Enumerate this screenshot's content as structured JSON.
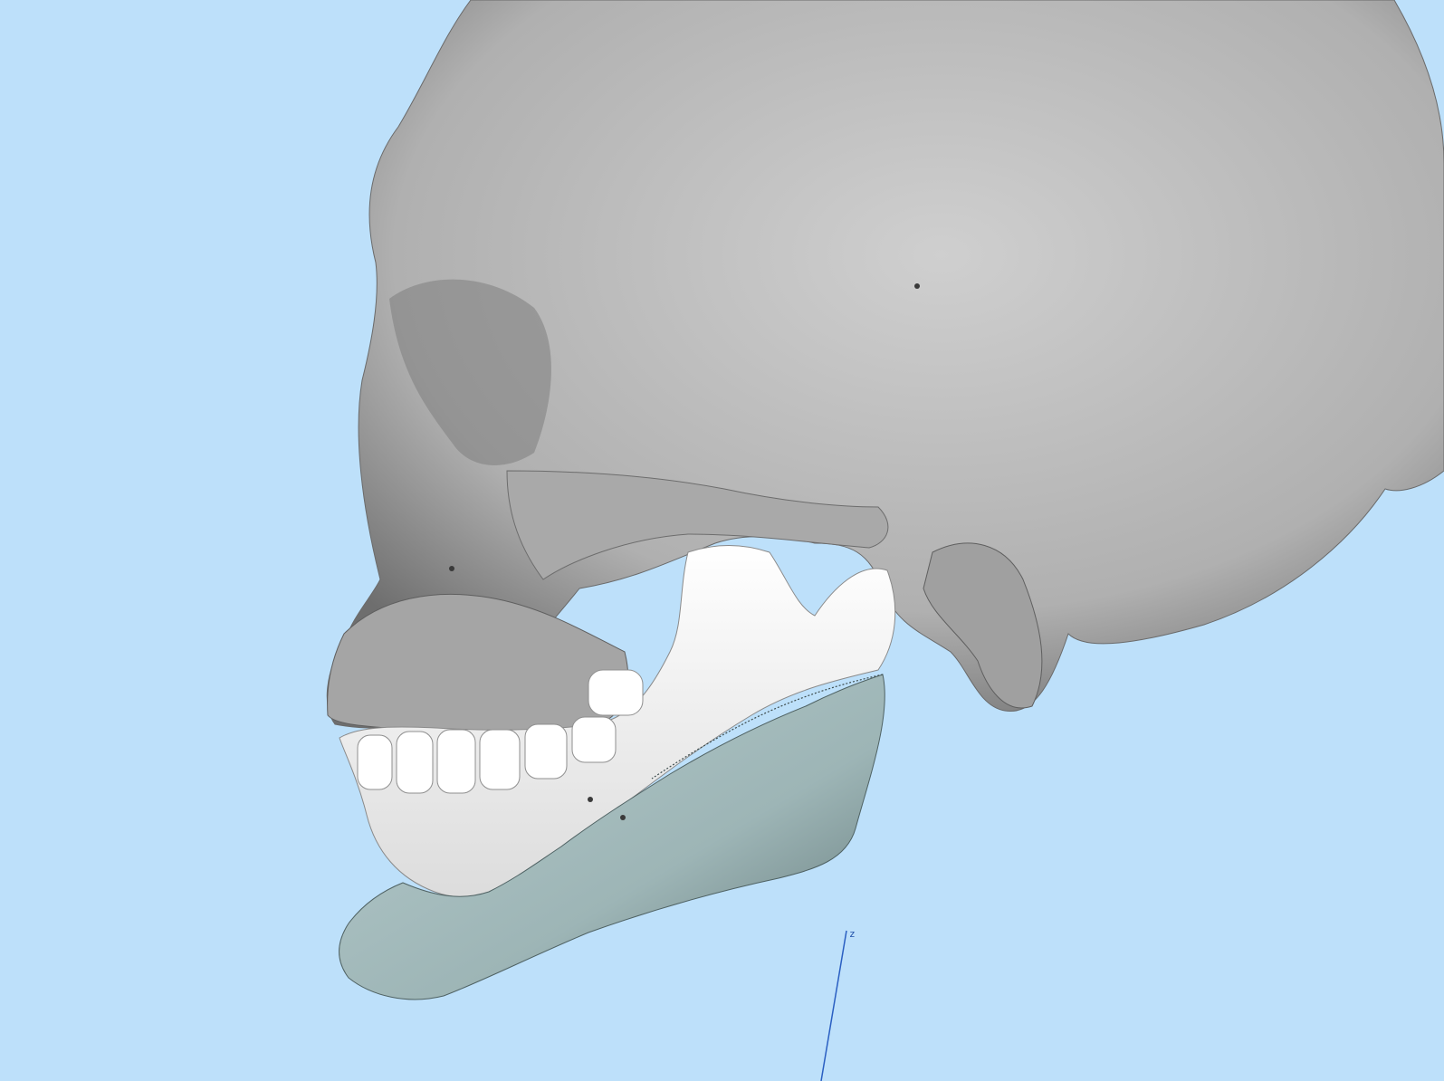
{
  "viewport": {
    "background_color": "#bde0fa",
    "models": [
      {
        "name": "skull",
        "color": "#b8b8b8"
      },
      {
        "name": "mandible",
        "color": "#f2f2f2"
      },
      {
        "name": "chin-implant",
        "color": "#9fb7b8"
      }
    ],
    "axis": {
      "label": "z",
      "color": "#1f4fa8"
    }
  }
}
